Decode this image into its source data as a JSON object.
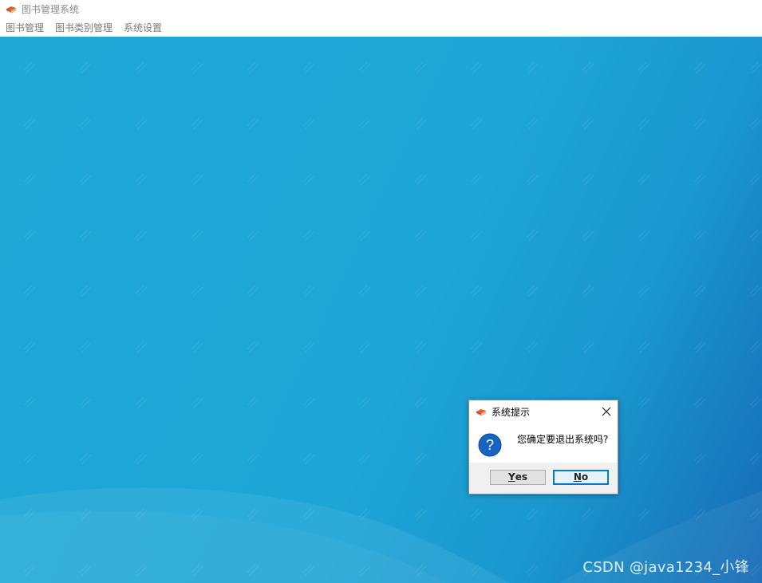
{
  "window": {
    "title": "图书管理系统",
    "icon": "books-icon"
  },
  "menubar": {
    "items": [
      {
        "label": "图书管理"
      },
      {
        "label": "图书类别管理"
      },
      {
        "label": "系统设置"
      }
    ]
  },
  "dialog": {
    "title": "系统提示",
    "icon": "books-icon",
    "message": "您确定要退出系统吗?",
    "question_icon": "question-icon",
    "close_icon": "close-icon",
    "buttons": {
      "yes_first": "Y",
      "yes_rest": "es",
      "no_first": "N",
      "no_rest": "o"
    }
  },
  "watermark": {
    "text": "CSDN @java1234_小锋"
  },
  "colors": {
    "desktop_blue": "#1fa8d6",
    "desktop_dark_blue": "#166ab5",
    "accent": "#0078d7",
    "question_blue": "#1565c0"
  }
}
